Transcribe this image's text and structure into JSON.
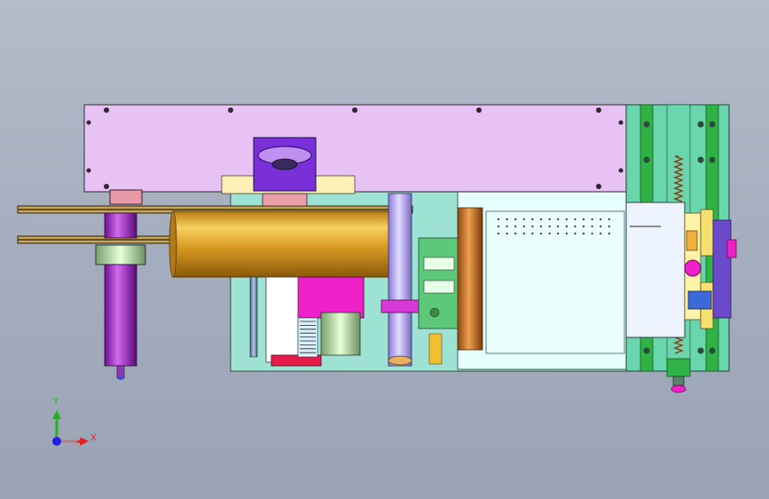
{
  "triad": {
    "x_label": "X",
    "y_label": "Y"
  },
  "colors": {
    "background": "#a6afbf",
    "frame_plate": "#e8c2f4",
    "base_plate": "#9fe6d6",
    "roller_gold": "#d9a02a",
    "belt_dark": "#3a3626",
    "cylinder_purple": "#b93cdc",
    "green_rail": "#2fb246",
    "motor_magenta": "#ee22c8",
    "light_cyan_panel": "#e6ffff",
    "axis_x": "#e42020",
    "axis_y": "#20b020",
    "axis_z": "#2020e0"
  },
  "icons": {
    "triad": "coordinate-triad-icon"
  }
}
